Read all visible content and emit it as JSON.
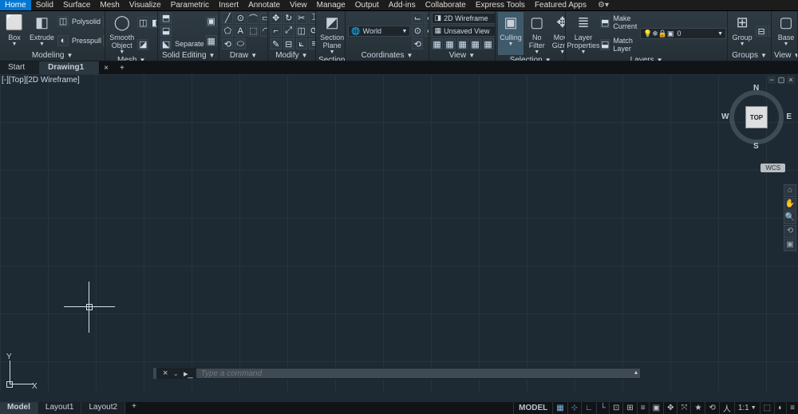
{
  "menubar": {
    "items": [
      "Home",
      "Solid",
      "Surface",
      "Mesh",
      "Visualize",
      "Parametric",
      "Insert",
      "Annotate",
      "View",
      "Manage",
      "Output",
      "Add-ins",
      "Collaborate",
      "Express Tools",
      "Featured Apps"
    ],
    "active_index": 0
  },
  "ribbon": {
    "panels": [
      {
        "title": "Modeling",
        "big": [
          {
            "label": "Box",
            "icon": "⬜",
            "name": "box-button"
          },
          {
            "label": "Extrude",
            "icon": "◧",
            "name": "extrude-button"
          }
        ],
        "side": [
          {
            "icon": "◫",
            "label": "Polysolid",
            "name": "polysolid-button"
          },
          {
            "icon": "◐",
            "label": "Presspull",
            "name": "presspull-button"
          }
        ],
        "grid_icons": [
          "◒",
          "◓",
          "◍",
          "⬢",
          "◐",
          "△"
        ]
      },
      {
        "title": "Mesh",
        "big": [
          {
            "label": "Smooth Object",
            "icon": "◯",
            "name": "smooth-object-button"
          }
        ],
        "grid_icons": [
          "◫",
          "◧",
          "◨",
          "◪"
        ]
      },
      {
        "title": "Solid Editing",
        "side": [
          {
            "icon": "⬒",
            "label": "",
            "name": "union-button"
          },
          {
            "icon": "⬓",
            "label": "",
            "name": "subtract-button"
          },
          {
            "icon": "⬕",
            "label": "Separate",
            "name": "separate-button"
          }
        ],
        "grid_icons": [
          "▣",
          "▤",
          "▥",
          "▦",
          "▧",
          "▨"
        ]
      },
      {
        "title": "Draw",
        "grid_icons": [
          "╱",
          "⊙",
          "⌒",
          "▭",
          "○",
          "⬠",
          "A",
          "⬚",
          "◠",
          "⬯",
          "⟲",
          "⬭"
        ]
      },
      {
        "title": "Modify",
        "grid_icons": [
          "✥",
          "↻",
          "✂",
          "⌶",
          "▲",
          "⌐",
          "⤢",
          "◫",
          "⟳",
          "△",
          "✎",
          "⊟",
          "⟀",
          "≡",
          "⊞"
        ]
      },
      {
        "title": "Section",
        "big": [
          {
            "label": "Section Plane",
            "icon": "◩",
            "name": "section-plane-button"
          }
        ]
      },
      {
        "title": "Coordinates",
        "grid_icons": [
          "⌙",
          "⌙",
          "⌙",
          "⌙",
          "⊙",
          "⌙",
          "↧",
          "↦",
          "⟲"
        ],
        "dropdown": {
          "icon": "🌐",
          "label": "World",
          "name": "world-dropdown"
        }
      },
      {
        "title": "View",
        "row_icons": [
          "▦",
          "▦",
          "▦",
          "▦",
          "▦"
        ],
        "dropdowns": [
          {
            "icon": "◨",
            "label": "2D Wireframe",
            "name": "visual-style-dropdown"
          },
          {
            "icon": "▦",
            "label": "Unsaved View",
            "name": "saved-view-dropdown"
          }
        ],
        "single_icons": [
          "▧",
          "▥"
        ]
      },
      {
        "title": "Selection",
        "big": [
          {
            "label": "Culling",
            "icon": "▣",
            "name": "culling-button",
            "highlight": true
          },
          {
            "label": "No Filter",
            "icon": "▢",
            "name": "no-filter-button"
          },
          {
            "label": "Move Gizmo",
            "icon": "✥",
            "name": "move-gizmo-button"
          }
        ]
      },
      {
        "title": "Layers",
        "big": [
          {
            "label": "Layer Properties",
            "icon": "≣",
            "name": "layer-properties-button"
          }
        ],
        "layer_combo": {
          "icons": "💡❄🔒▣",
          "label": "0",
          "name": "layer-dropdown"
        },
        "side": [
          {
            "icon": "⬒",
            "label": "Make Current",
            "name": "make-current-button"
          },
          {
            "icon": "⬓",
            "label": "Match Layer",
            "name": "match-layer-button"
          }
        ],
        "grid_icons": [
          "▣",
          "▣",
          "▣",
          "▣",
          "▣",
          "▣",
          "▣",
          "▣",
          "▣"
        ]
      },
      {
        "title": "Groups",
        "big": [
          {
            "label": "Group",
            "icon": "⊞",
            "name": "group-button"
          }
        ],
        "grid_icons": [
          "⊟",
          "⊡"
        ]
      },
      {
        "title": "View",
        "big": [
          {
            "label": "Base",
            "icon": "▢",
            "name": "base-view-button"
          }
        ]
      }
    ]
  },
  "filetabs": {
    "items": [
      "Start",
      "Drawing1"
    ],
    "active_index": 1
  },
  "viewport": {
    "label": "[-][Top][2D Wireframe]",
    "viewcube": {
      "face": "TOP",
      "n": "N",
      "e": "E",
      "s": "S",
      "w": "W"
    },
    "wcs_badge": "WCS",
    "ucs": {
      "x": "X",
      "y": "Y"
    }
  },
  "commandline": {
    "placeholder": "Type a command"
  },
  "layouttabs": {
    "items": [
      "Model",
      "Layout1",
      "Layout2"
    ],
    "active_index": 0
  },
  "statusbar": {
    "model_label": "MODEL",
    "scale": "1:1",
    "buttons": [
      "▦",
      "⊹",
      "∟",
      "└",
      "⊡",
      "⊞",
      "≡",
      "▣",
      "✥",
      "⤧",
      "★",
      "⟲",
      "人",
      "⬚",
      "◐",
      "≡"
    ]
  }
}
